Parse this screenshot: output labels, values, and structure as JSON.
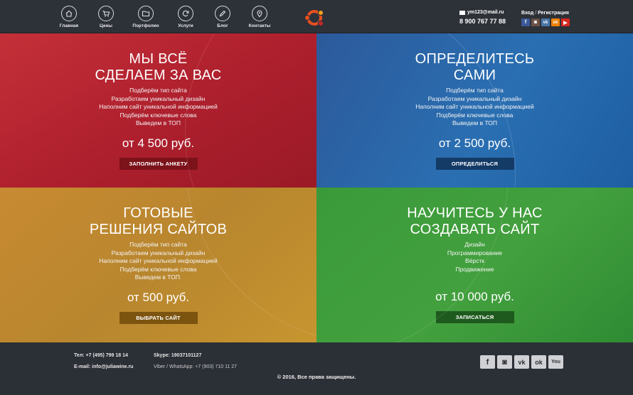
{
  "nav": [
    {
      "label": "Главная",
      "icon": "home-icon"
    },
    {
      "label": "Цены",
      "icon": "cart-icon"
    },
    {
      "label": "Портфолио",
      "icon": "folder-icon"
    },
    {
      "label": "Услуги",
      "icon": "refresh-icon"
    },
    {
      "label": "Блог",
      "icon": "pencil-icon"
    },
    {
      "label": "Контакты",
      "icon": "location-icon"
    }
  ],
  "header": {
    "email": "ym123@mail.ru",
    "phone": "8 900 767 77 88",
    "login": "Вход",
    "separator": "/",
    "register": "Регистрация"
  },
  "social_small": [
    {
      "icon": "facebook-icon",
      "glyph": "f",
      "color": "#3b5998"
    },
    {
      "icon": "instagram-icon",
      "glyph": "◙",
      "color": "#6b5147"
    },
    {
      "icon": "vk-icon",
      "glyph": "vk",
      "color": "#4a76a8"
    },
    {
      "icon": "odnoklassniki-icon",
      "glyph": "ok",
      "color": "#ee8208"
    },
    {
      "icon": "youtube-icon",
      "glyph": "▶",
      "color": "#d8281f"
    }
  ],
  "tiles": [
    {
      "title_line1": "МЫ ВСЁ",
      "title_line2": "СДЕЛАЕМ ЗА ВАС",
      "items": [
        "Подберём тип сайта",
        "Разработаем уникальный дизайн",
        "Наполним сайт уникальной информацией",
        "Подберём ключевые слова",
        "Выведем в ТОП"
      ],
      "price": "от 4 500 руб.",
      "button": "ЗАПОЛНИТЬ АНКЕТУ"
    },
    {
      "title_line1": "ОПРЕДЕЛИТЕСЬ",
      "title_line2": "САМИ",
      "items": [
        "Подберём тип сайта",
        "Разработаем уникальный дизайн",
        "Наполним сайт уникальной информацией",
        "Подберём ключевые слова",
        "Выведем в ТОП"
      ],
      "price": "от 2 500 руб.",
      "button": "ОПРЕДЕЛИТЬСЯ"
    },
    {
      "title_line1": "ГОТОВЫЕ",
      "title_line2": "РЕШЕНИЯ САЙТОВ",
      "items": [
        "Подберём тип сайта",
        "Разработаем уникальный дизайн",
        "Наполним сайт уникальной информацией",
        "Подберём ключевые слова",
        "Выведем в ТОП."
      ],
      "price": "от 500 руб.",
      "button": "ВЫБРАТЬ САЙТ"
    },
    {
      "title_line1": "НАУЧИТЕСЬ У НАС",
      "title_line2": "СОЗДАВАТЬ САЙТ",
      "items": [
        "Дизайн",
        "Программирование",
        "Вёрстк",
        "Продвижение"
      ],
      "price": "от 10 000 руб.",
      "button": "ЗАПИСАТЬСЯ"
    }
  ],
  "footer": {
    "tel": "Тел: +7 (495) 799 18 14",
    "skype": "Skype: 19037101127",
    "email": "E-mail: info@juliawine.ru",
    "viber": "Viber / WhatsApp: +7 (903) 710 11 27",
    "copyright": "© 2016, Все права защищены."
  },
  "social_big": [
    {
      "icon": "facebook-icon",
      "glyph": "f"
    },
    {
      "icon": "instagram-icon",
      "glyph": "◙"
    },
    {
      "icon": "vk-icon",
      "glyph": "vk"
    },
    {
      "icon": "odnoklassniki-icon",
      "glyph": "ok"
    },
    {
      "icon": "youtube-icon",
      "glyph": "You"
    }
  ]
}
